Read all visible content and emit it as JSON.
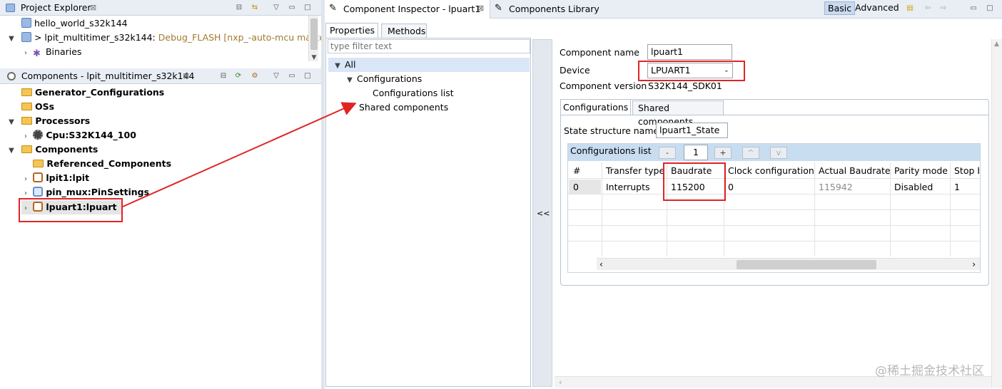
{
  "project_explorer": {
    "title": "Project Explorer",
    "items": [
      {
        "label": "hello_world_s32k144",
        "suffix": ""
      },
      {
        "label": "> lpit_multitimer_s32k144:",
        "suffix": "Debug_FLASH [nxp_-auto-mcu master]"
      },
      {
        "label": "Binaries",
        "suffix": ""
      }
    ]
  },
  "components_view": {
    "title": "Components - lpit_multitimer_s32k144",
    "items": [
      {
        "label": "Generator_Configurations"
      },
      {
        "label": "OSs"
      },
      {
        "label": "Processors"
      },
      {
        "label": "Cpu:S32K144_100"
      },
      {
        "label": "Components"
      },
      {
        "label": "Referenced_Components"
      },
      {
        "label": "lpit1:lpit"
      },
      {
        "label": "pin_mux:PinSettings"
      },
      {
        "label": "lpuart1:lpuart"
      }
    ]
  },
  "editor_tabs": {
    "inspector": "Component Inspector - lpuart1",
    "library": "Components Library",
    "mode_basic": "Basic",
    "mode_advanced": "Advanced"
  },
  "property_nav": {
    "tab_properties": "Properties",
    "tab_methods": "Methods",
    "filter_placeholder": "type filter text",
    "tree": {
      "all": "All",
      "configurations": "Configurations",
      "configurations_list": "Configurations list",
      "shared_components": "Shared components"
    },
    "collapse_label": "<<"
  },
  "inspector": {
    "component_name_label": "Component name",
    "component_name_value": "lpuart1",
    "device_label": "Device",
    "device_value": "LPUART1",
    "component_version_label": "Component version",
    "component_version_value": "S32K144_SDK01",
    "inner_tabs": {
      "configurations": "Configurations",
      "shared": "Shared components"
    },
    "state_structure_label": "State structure name",
    "state_structure_value": "lpuart1_State",
    "config_list": {
      "title": "Configurations list",
      "minus": "-",
      "index": "1",
      "plus": "+",
      "up": "^",
      "down": "v",
      "columns": [
        "#",
        "Transfer type",
        "Baudrate",
        "Clock configuration",
        "Actual Baudrate",
        "Parity mode",
        "Stop b"
      ],
      "rows": [
        [
          "0",
          "Interrupts",
          "115200",
          "0",
          "115942",
          "Disabled",
          "1"
        ]
      ]
    }
  },
  "watermark": "@稀土掘金技术社区",
  "colors": {
    "highlight": "#e02424",
    "selection": "#d8e6f7",
    "section_header": "#c9ddf1"
  }
}
